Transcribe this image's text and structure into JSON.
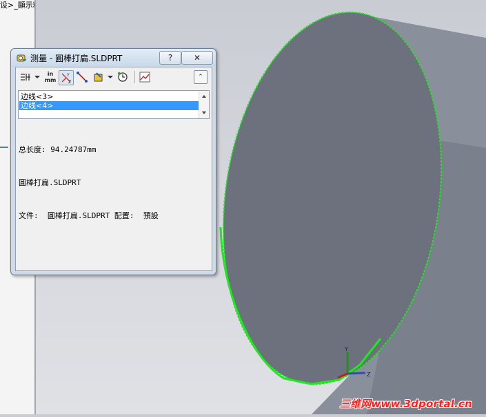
{
  "left_pane": {
    "top_text": "设>_顯示粃"
  },
  "dialog": {
    "title": "测量 - 圓棒打扁.SLDPRT",
    "help_label": "?",
    "close_label": "✕",
    "toolbar": {
      "units_label": "in\nmm",
      "collapse_label": "⌃"
    },
    "list_items": [
      "边线<3>",
      "边线<4>"
    ],
    "selected_index": 1,
    "results": [
      "总长度: 94.24787mm",
      "圓棒打扁.SLDPRT",
      "文件:  圓棒打扁.SLDPRT 配置:  預設"
    ]
  },
  "viewport": {
    "edge_color": "#1ee81e",
    "face_color": "#6c717d",
    "body_color": "#8e939f",
    "triad_labels": {
      "y": "Y",
      "z": "Z"
    }
  },
  "watermark": "三维网www.3dportal.cn"
}
